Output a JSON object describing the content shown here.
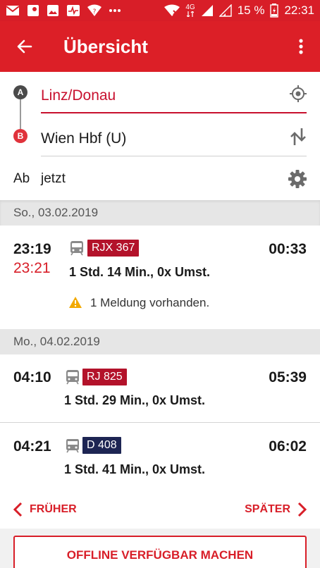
{
  "statusbar": {
    "signal_label": "4G",
    "battery": "15 %",
    "clock": "22:31"
  },
  "appbar": {
    "title": "Übersicht"
  },
  "route": {
    "marker_a": "A",
    "marker_b": "B",
    "from": "Linz/Donau",
    "to": "Wien Hbf (U)",
    "time_label": "Ab",
    "time_value": "jetzt"
  },
  "days": [
    {
      "date": "So., 03.02.2019",
      "connections": [
        {
          "departure": "23:19",
          "departure_actual": "23:21",
          "train": "RJX 367",
          "arrival": "00:33",
          "duration": "1 Std. 14 Min., 0x Umst.",
          "message": "1 Meldung vorhanden."
        }
      ]
    },
    {
      "date": "Mo., 04.02.2019",
      "connections": [
        {
          "departure": "04:10",
          "train": "RJ 825",
          "arrival": "05:39",
          "duration": "1 Std. 29 Min., 0x Umst."
        },
        {
          "departure": "04:21",
          "train": "D 408",
          "arrival": "06:02",
          "duration": "1 Std. 41 Min., 0x Umst."
        }
      ]
    }
  ],
  "nav": {
    "earlier": "FRÜHER",
    "later": "SPÄTER"
  },
  "offline_button": "OFFLINE VERFÜGBAR MACHEN",
  "colors": {
    "brand_red": "#dc1f27",
    "badge_red": "#b3122a",
    "badge_navy": "#1d2553",
    "warning": "#f2a900"
  }
}
